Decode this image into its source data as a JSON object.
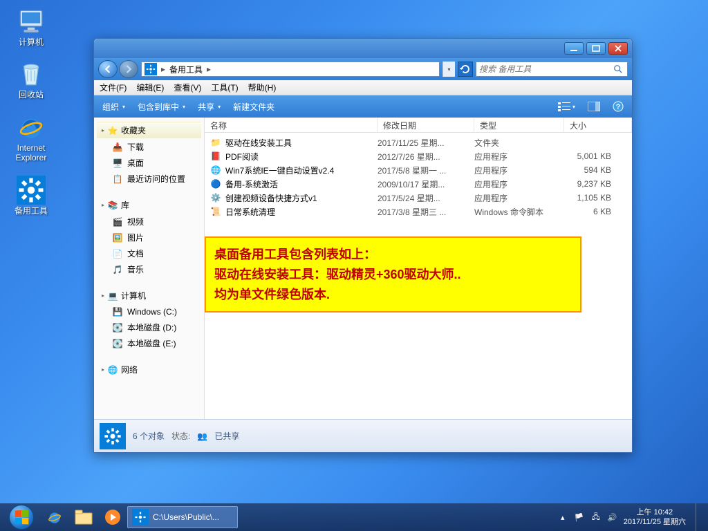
{
  "desktop": {
    "computer": "计算机",
    "recycle": "回收站",
    "ie": "Internet\nExplorer",
    "tools": "备用工具"
  },
  "window": {
    "breadcrumb": "备用工具",
    "search_placeholder": "搜索 备用工具",
    "menubar": [
      "文件(F)",
      "编辑(E)",
      "查看(V)",
      "工具(T)",
      "帮助(H)"
    ],
    "toolbar": {
      "organize": "组织",
      "include": "包含到库中",
      "share": "共享",
      "newfolder": "新建文件夹"
    },
    "columns": {
      "name": "名称",
      "date": "修改日期",
      "type": "类型",
      "size": "大小"
    },
    "files": [
      {
        "name": "驱动在线安装工具",
        "date": "2017/11/25 星期...",
        "type": "文件夹",
        "size": "",
        "icon": "folder"
      },
      {
        "name": "PDF阅读",
        "date": "2012/7/26 星期...",
        "type": "应用程序",
        "size": "5,001 KB",
        "icon": "pdf"
      },
      {
        "name": "Win7系统IE一键自动设置v2.4",
        "date": "2017/5/8 星期一 ...",
        "type": "应用程序",
        "size": "594 KB",
        "icon": "ie"
      },
      {
        "name": "备用-系统激活",
        "date": "2009/10/17 星期...",
        "type": "应用程序",
        "size": "9,237 KB",
        "icon": "globe"
      },
      {
        "name": "创建视频设备快捷方式v1",
        "date": "2017/5/24 星期...",
        "type": "应用程序",
        "size": "1,105 KB",
        "icon": "gear"
      },
      {
        "name": "日常系统清理",
        "date": "2017/3/8 星期三 ...",
        "type": "Windows 命令脚本",
        "size": "6 KB",
        "icon": "script"
      }
    ],
    "sidebar": {
      "favorites": "收藏夹",
      "fav_items": [
        "下载",
        "桌面",
        "最近访问的位置"
      ],
      "library": "库",
      "lib_items": [
        "视频",
        "图片",
        "文档",
        "音乐"
      ],
      "computer": "计算机",
      "drives": [
        "Windows (C:)",
        "本地磁盘 (D:)",
        "本地磁盘 (E:)"
      ],
      "network": "网络"
    },
    "note_l1": "桌面备用工具包含列表如上：",
    "note_l2": "驱动在线安装工具：驱动精灵+360驱动大师..",
    "note_l3": "均为单文件绿色版本.",
    "status": {
      "count": "6 个对象",
      "state_label": "状态:",
      "state_val": "已共享"
    }
  },
  "taskbar": {
    "active_task": "C:\\Users\\Public\\...",
    "time": "上午 10:42",
    "date": "2017/11/25 星期六"
  }
}
